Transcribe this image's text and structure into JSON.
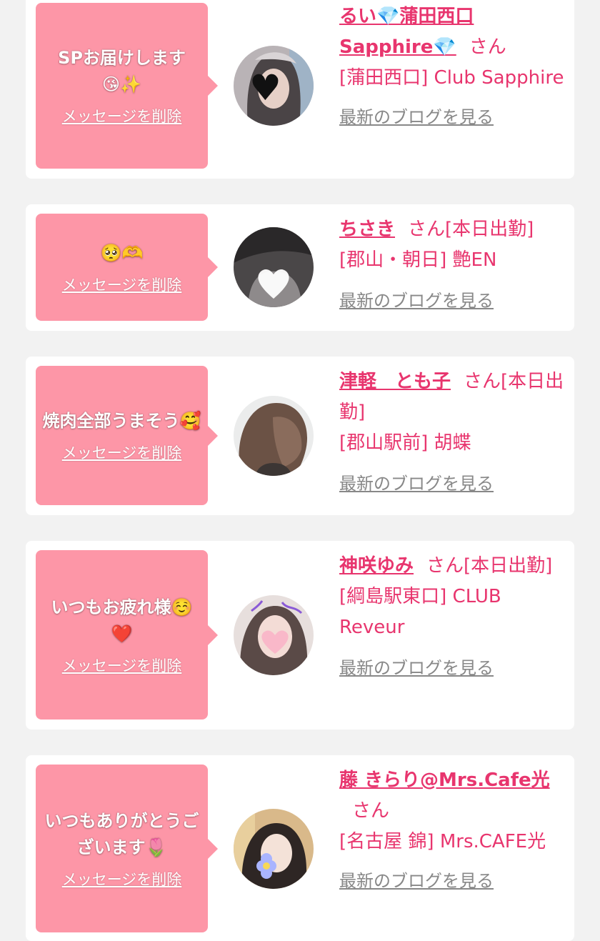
{
  "accent_color": "#e8356e",
  "bubble_color": "#fd96a7",
  "entries": [
    {
      "message": "SPお届けします😘✨",
      "delete_label": "メッセージを削除",
      "name": "るい💎蒲田西口Sapphire💎",
      "suffix": "さん",
      "shop": "[蒲田西口] Club Sapphire",
      "blog_label": "最新のブログを見る",
      "avatar_icon": "black-heart-sticker"
    },
    {
      "message": "🥺🫶",
      "delete_label": "メッセージを削除",
      "name": "ちさき",
      "suffix": "さん[本日出勤]",
      "shop": "[郡山・朝日] 艶EN",
      "blog_label": "最新のブログを見る",
      "avatar_icon": "white-heart-sticker"
    },
    {
      "message": "焼肉全部うまそう🥰",
      "delete_label": "メッセージを削除",
      "name": "津軽　とも子",
      "suffix": "さん[本日出勤]",
      "shop": "[郡山駅前] 胡蝶",
      "blog_label": "最新のブログを見る",
      "avatar_icon": "hair-photo"
    },
    {
      "message": "いつもお疲れ様☺️❤️",
      "delete_label": "メッセージを削除",
      "name": "神咲ゆみ",
      "suffix": "さん[本日出勤]",
      "shop": "[綱島駅東口] CLUB Reveur",
      "blog_label": "最新のブログを見る",
      "avatar_icon": "pink-heart-sticker"
    },
    {
      "message": "いつもありがとうございます🌷",
      "delete_label": "メッセージを削除",
      "name": "藤 きらり@Mrs.Cafe光",
      "suffix": "さん",
      "shop": "[名古屋 錦] Mrs.CAFE光",
      "blog_label": "最新のブログを見る",
      "avatar_icon": "flower-sticker"
    }
  ]
}
